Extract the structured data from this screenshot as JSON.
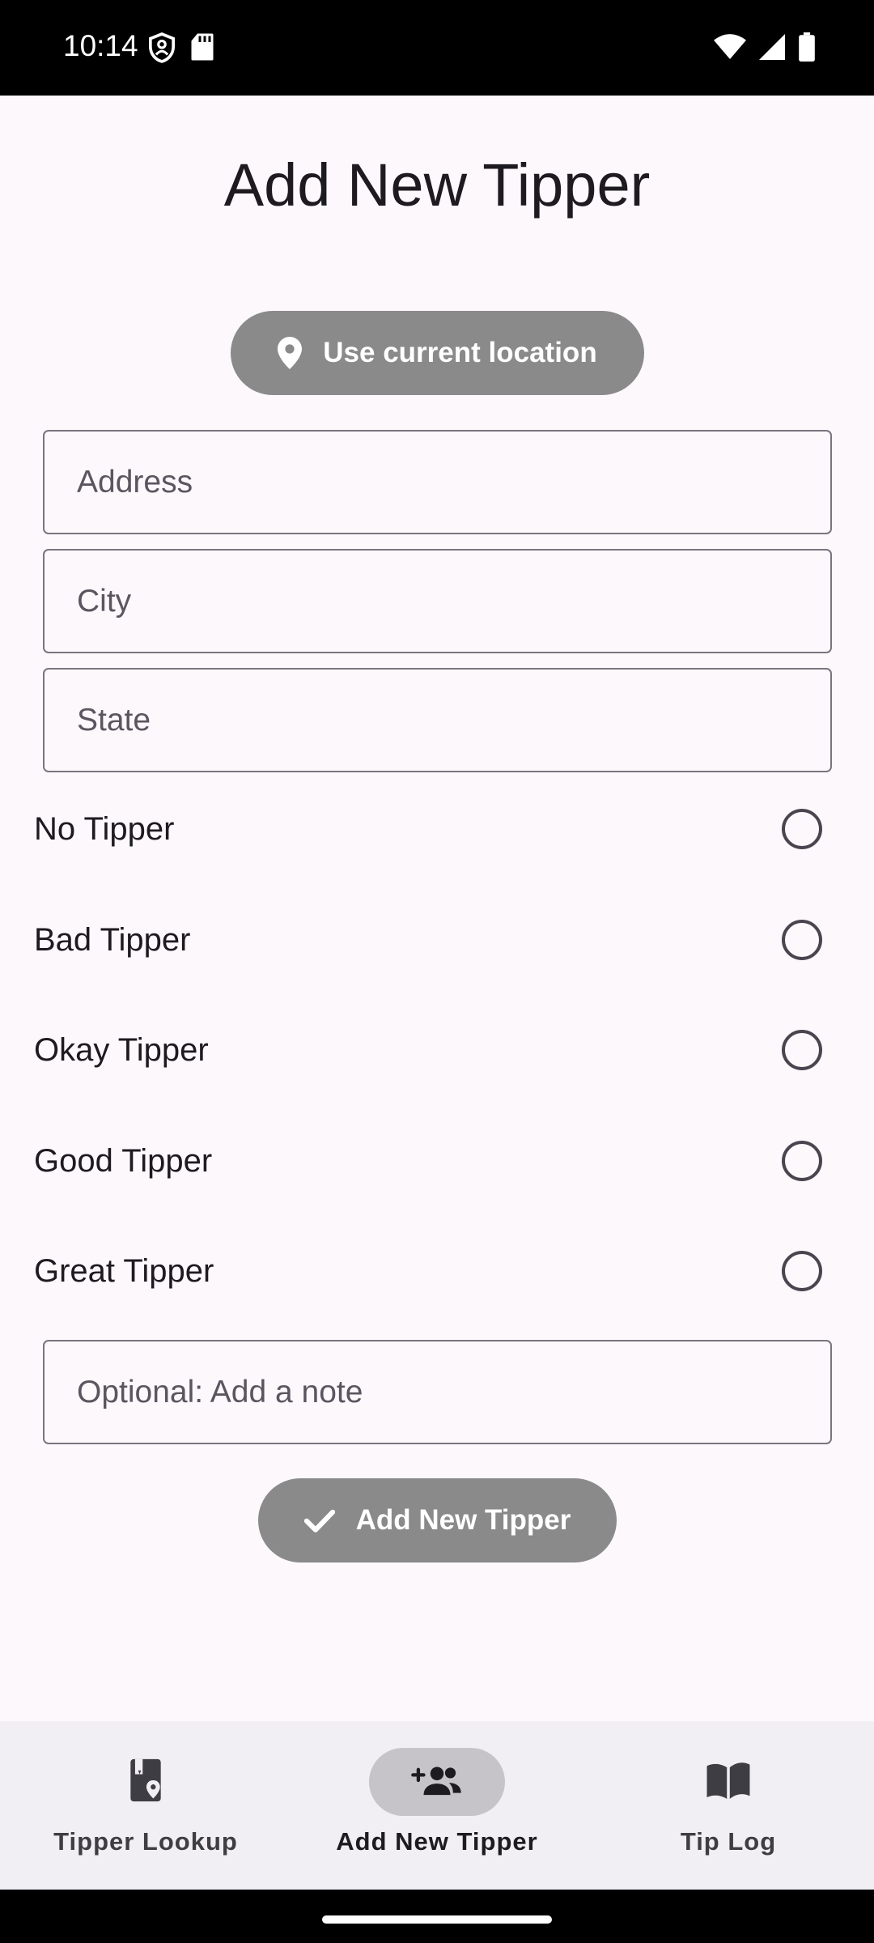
{
  "status_bar": {
    "time": "10:14",
    "left_icons": [
      "shield-icon",
      "sd-card-icon"
    ],
    "right_icons": [
      "wifi-icon",
      "signal-icon",
      "battery-icon"
    ]
  },
  "page": {
    "title": "Add New Tipper"
  },
  "location_button": {
    "label": "Use current location",
    "icon": "location-pin-icon"
  },
  "fields": {
    "address_placeholder": "Address",
    "city_placeholder": "City",
    "state_placeholder": "State",
    "note_placeholder": "Optional: Add a note"
  },
  "ratings": [
    {
      "label": "No Tipper",
      "selected": false
    },
    {
      "label": "Bad Tipper",
      "selected": false
    },
    {
      "label": "Okay Tipper",
      "selected": false
    },
    {
      "label": "Good Tipper",
      "selected": false
    },
    {
      "label": "Great Tipper",
      "selected": false
    }
  ],
  "submit_button": {
    "label": "Add New Tipper",
    "icon": "check-icon"
  },
  "bottom_nav": {
    "items": [
      {
        "label": "Tipper Lookup",
        "icon": "map-pin-book-icon",
        "active": false
      },
      {
        "label": "Add New Tipper",
        "icon": "add-person-icon",
        "active": true
      },
      {
        "label": "Tip Log",
        "icon": "open-book-icon",
        "active": false
      }
    ]
  },
  "colors": {
    "background": "#fdf8fc",
    "button_gray": "#8a8a8a",
    "nav_background": "#f2eff4",
    "nav_active_pill": "#c6c4c8",
    "outline": "#79747e"
  }
}
